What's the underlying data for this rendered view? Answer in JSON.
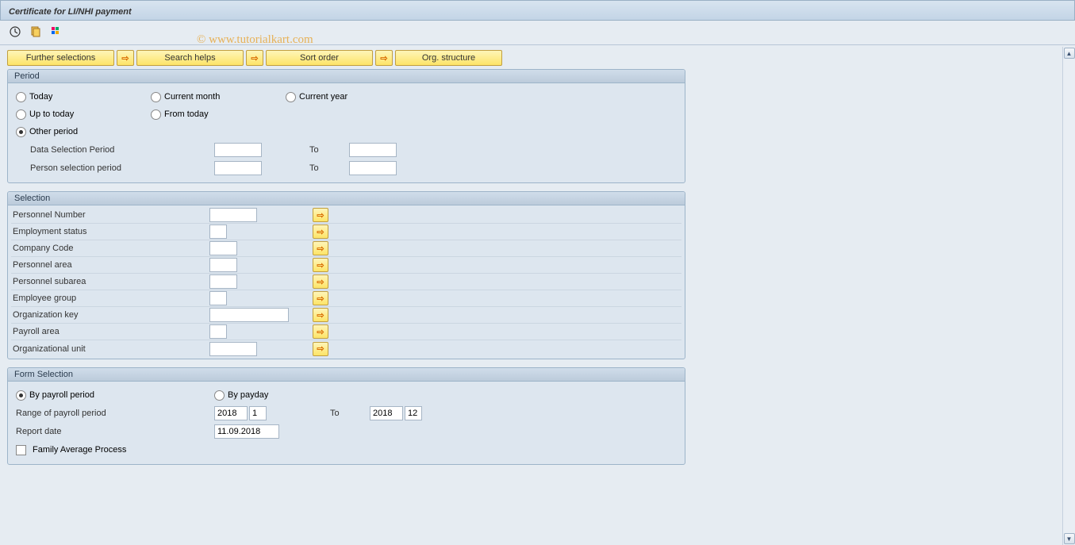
{
  "title": "Certificate for LI/NHI payment",
  "watermark": "© www.tutorialkart.com",
  "buttons": {
    "further_selections": "Further selections",
    "search_helps": "Search helps",
    "sort_order": "Sort order",
    "org_structure": "Org. structure"
  },
  "period": {
    "title": "Period",
    "today": "Today",
    "current_month": "Current month",
    "current_year": "Current year",
    "up_to_today": "Up to today",
    "from_today": "From today",
    "other_period": "Other period",
    "data_selection_period": "Data Selection Period",
    "person_selection_period": "Person selection period",
    "to": "To"
  },
  "selection": {
    "title": "Selection",
    "fields": [
      {
        "label": "Personnel Number"
      },
      {
        "label": "Employment status"
      },
      {
        "label": "Company Code"
      },
      {
        "label": "Personnel area"
      },
      {
        "label": "Personnel subarea"
      },
      {
        "label": "Employee group"
      },
      {
        "label": "Organization key"
      },
      {
        "label": "Payroll area"
      },
      {
        "label": "Organizational unit"
      }
    ]
  },
  "form_selection": {
    "title": "Form Selection",
    "by_payroll_period": "By payroll period",
    "by_payday": "By payday",
    "range_of_payroll": "Range of payroll period",
    "year_from": "2018",
    "period_from": "1",
    "to": "To",
    "year_to": "2018",
    "period_to": "12",
    "report_date": "Report date",
    "report_date_value": "11.09.2018",
    "family_avg": "Family Average Process"
  }
}
